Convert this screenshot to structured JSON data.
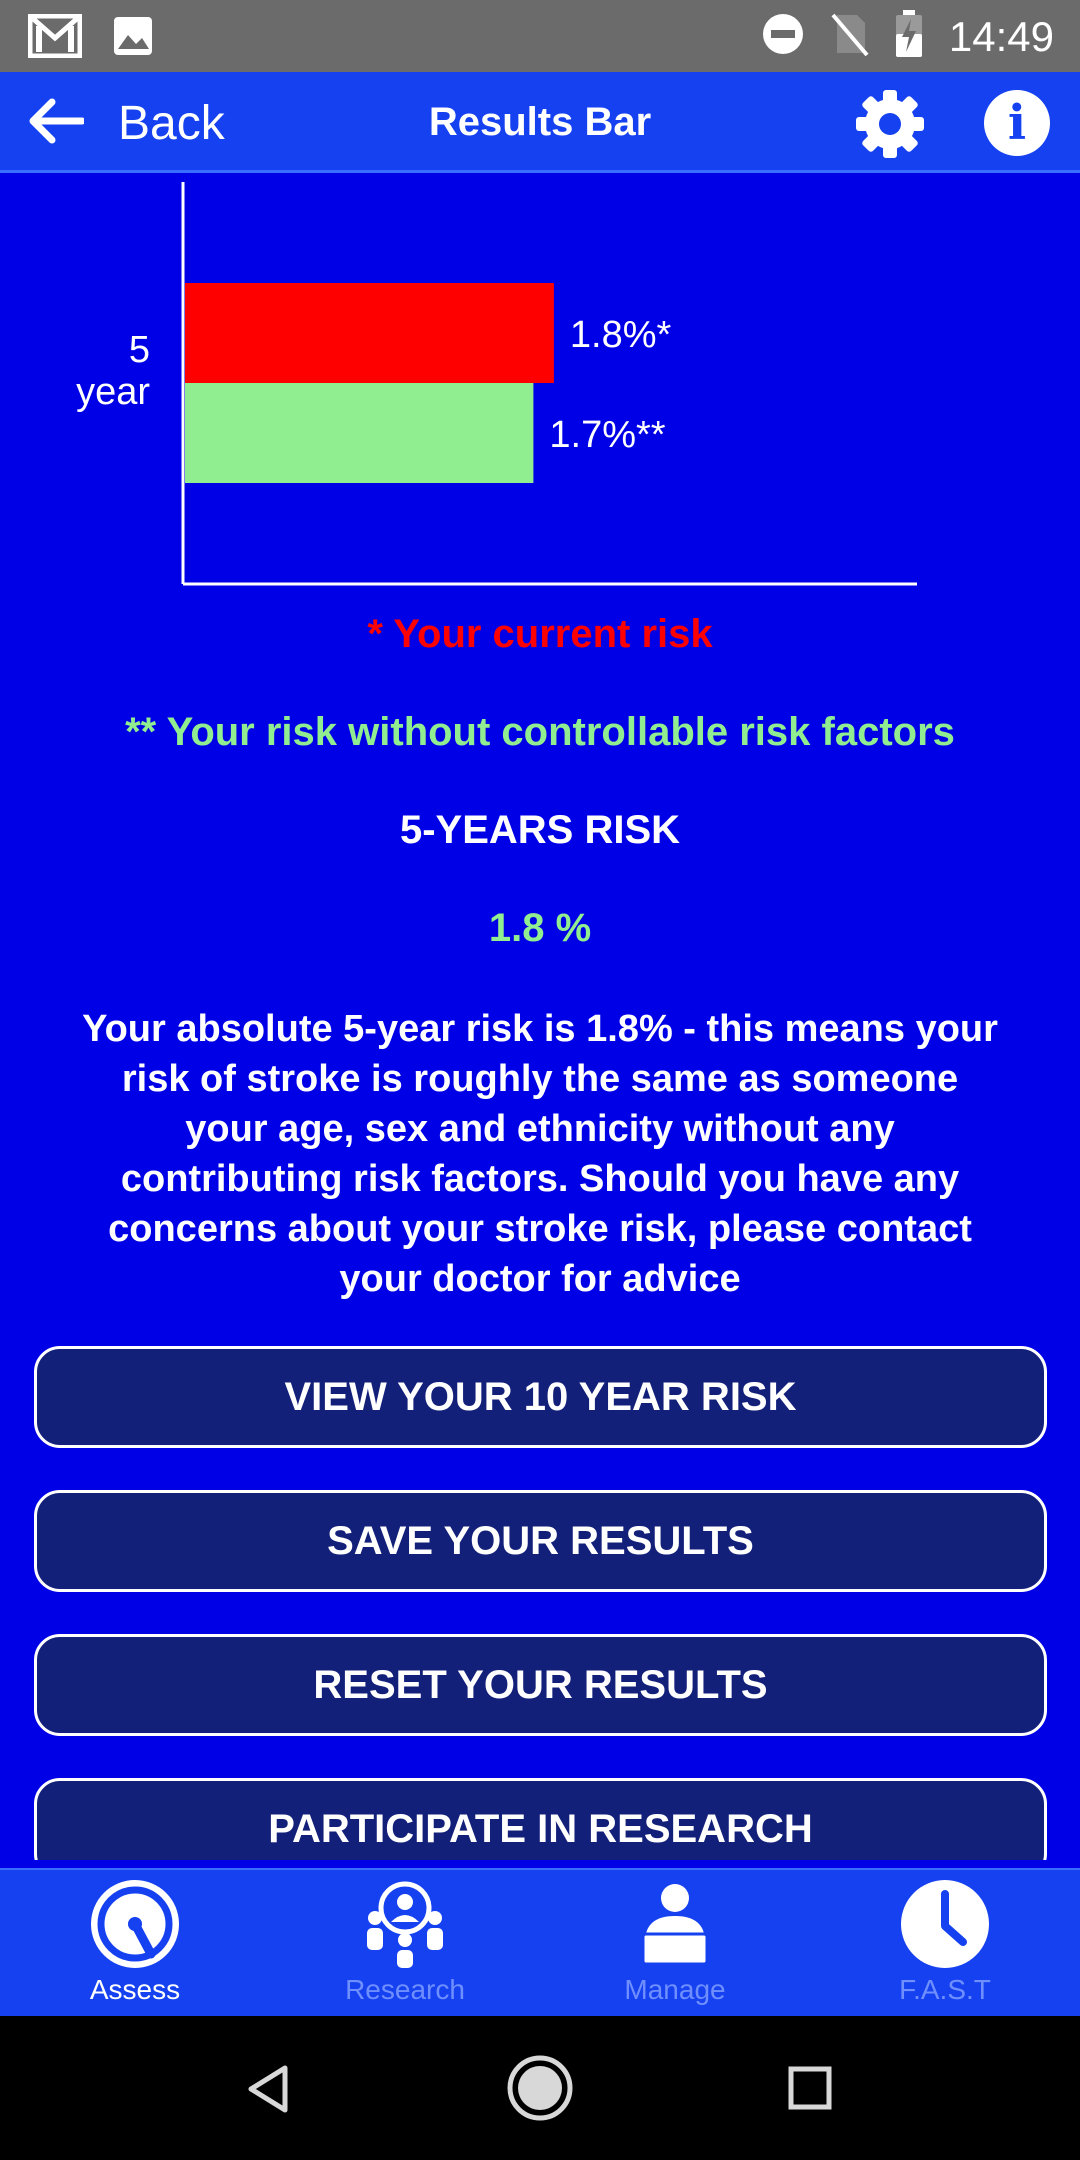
{
  "status_bar": {
    "time": "14:49"
  },
  "header": {
    "back_label": "Back",
    "title": "Results Bar"
  },
  "chart_data": {
    "type": "bar",
    "orientation": "horizontal",
    "categories": [
      "5 year"
    ],
    "category_lines": [
      "5",
      "year"
    ],
    "series": [
      {
        "values": [
          1.8
        ],
        "color": "#ff0000",
        "data_label": "1.8%*"
      },
      {
        "values": [
          1.7
        ],
        "color": "#90ee90",
        "data_label": "1.7%**"
      }
    ],
    "xlim": [
      0,
      3
    ],
    "grid": false
  },
  "legend": {
    "current_risk": "* Your current risk",
    "without_factors": "** Your risk without controllable risk factors"
  },
  "risk": {
    "heading": "5-YEARS RISK",
    "value": "1.8 %",
    "description": "Your absolute 5-year risk is 1.8% - this means your risk of stroke is roughly the same as someone your age, sex and ethnicity without any contributing risk factors. Should you have any concerns about your stroke risk, please contact your doctor for advice"
  },
  "buttons": {
    "view_10_year": "VIEW YOUR 10 YEAR RISK",
    "save": "SAVE YOUR RESULTS",
    "reset": "RESET YOUR RESULTS",
    "participate": "PARTICIPATE IN RESEARCH"
  },
  "bottom_nav": {
    "assess": "Assess",
    "research": "Research",
    "manage": "Manage",
    "fast": "F.A.S.T",
    "active": "Assess"
  },
  "colors": {
    "background": "#0000e6",
    "header": "#1541f0",
    "button_fill": "#13207a",
    "current_risk": "#ff0000",
    "reduced_risk": "#90ee90"
  }
}
